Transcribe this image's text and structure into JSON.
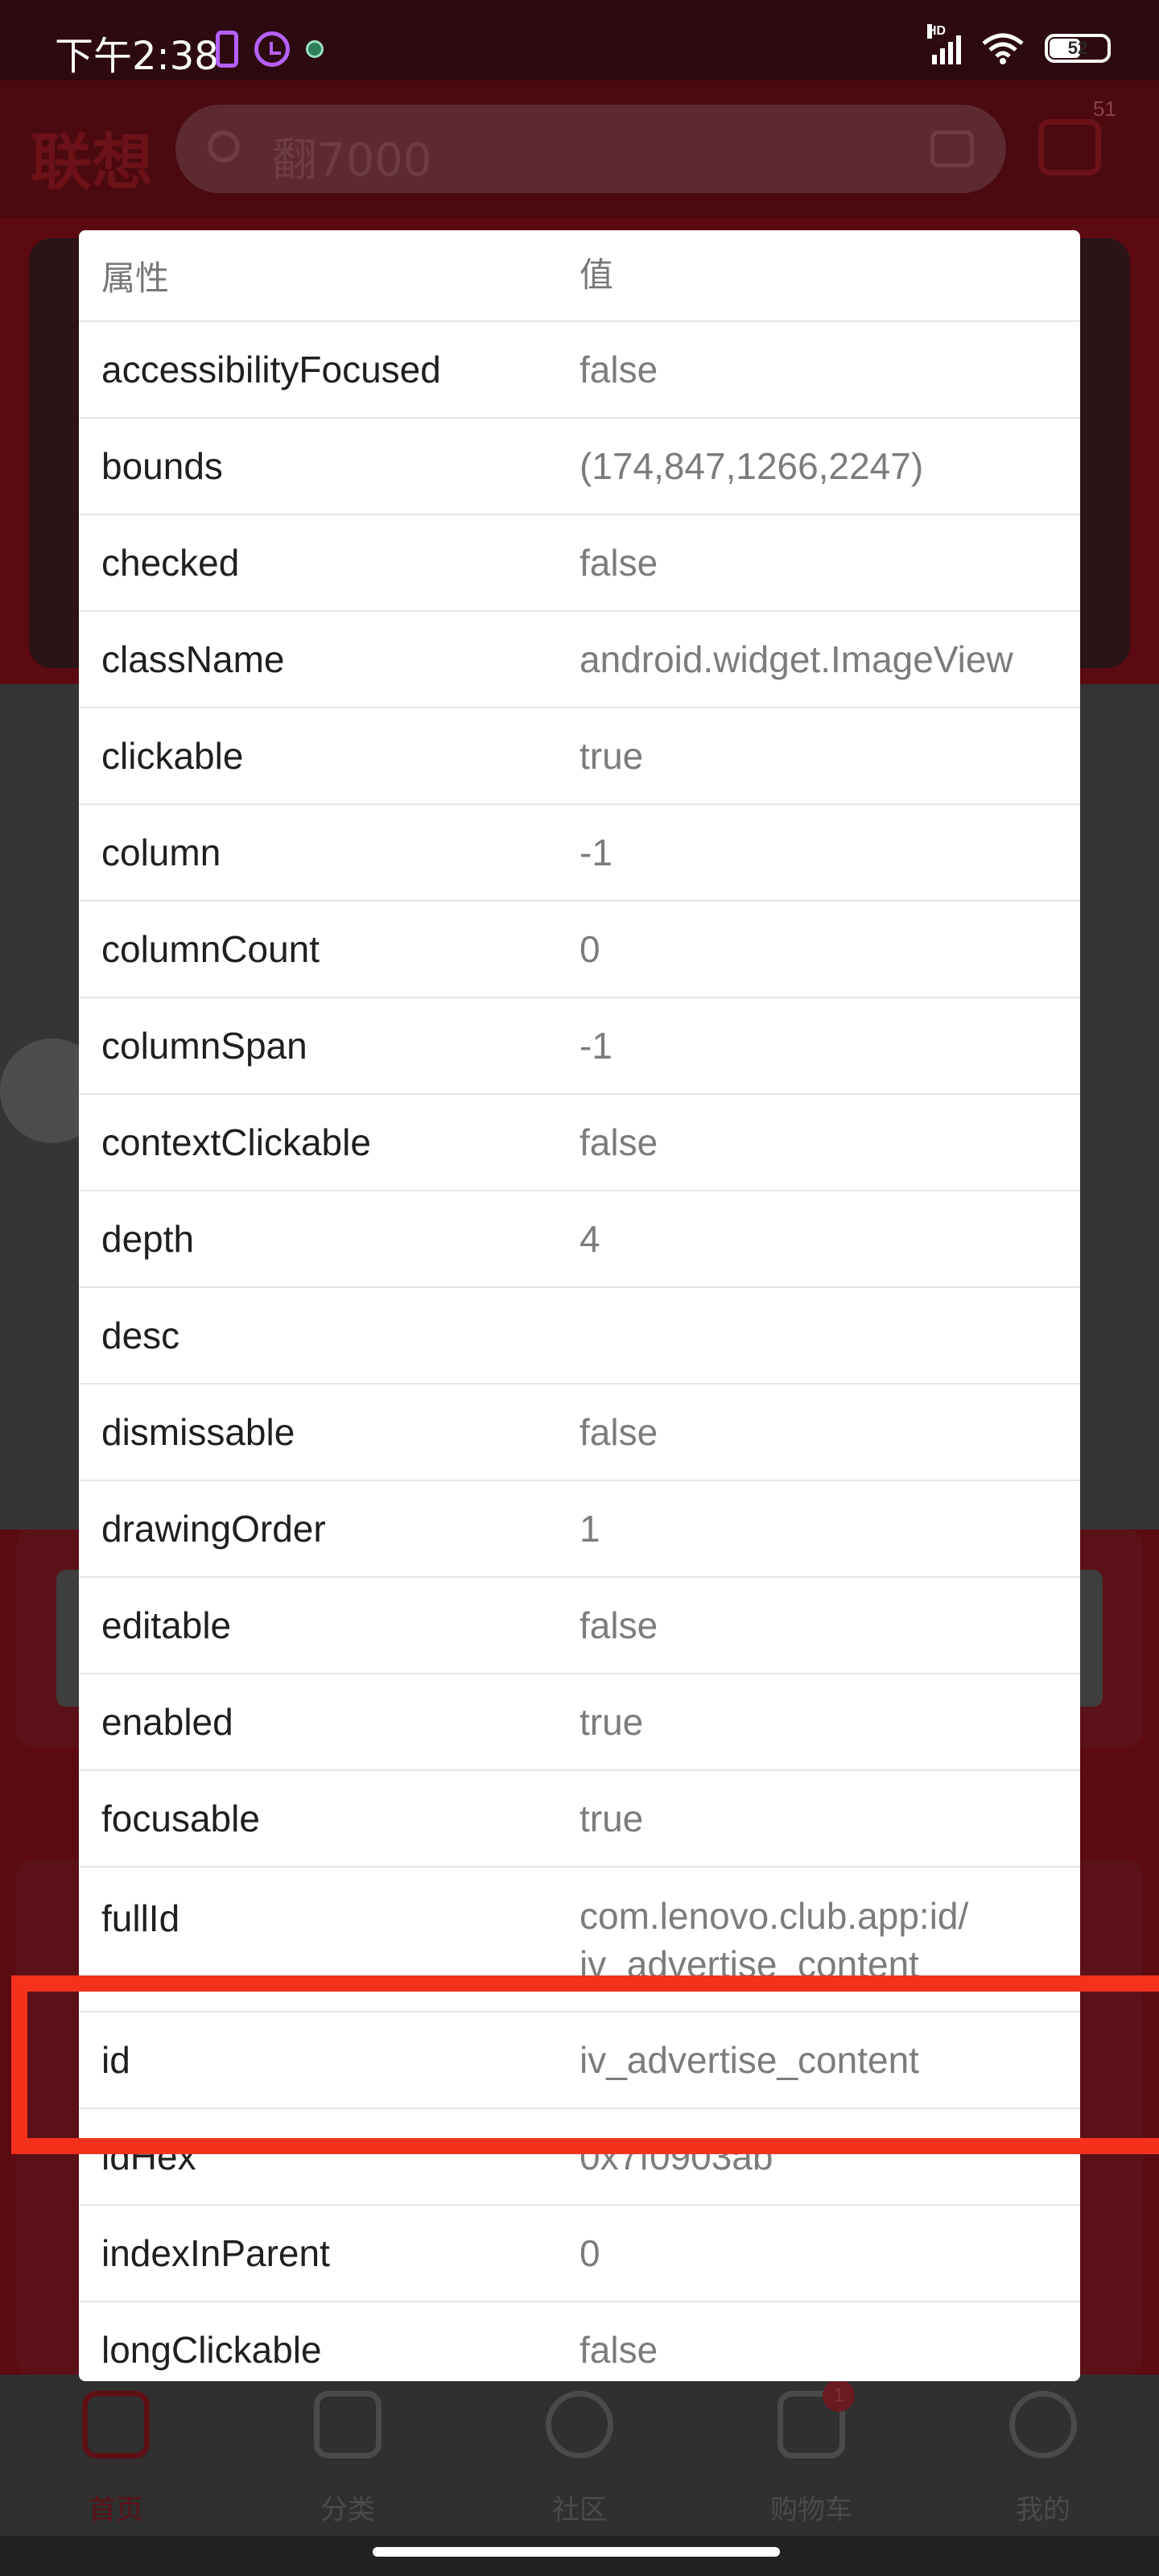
{
  "status_bar": {
    "time": "下午2:38",
    "battery": "52",
    "network_label": "HD"
  },
  "app": {
    "logo": "联想",
    "search_placeholder": "翻7000",
    "message_count": "51"
  },
  "bottom_nav": [
    {
      "label": "首页",
      "icon": "home-icon"
    },
    {
      "label": "分类",
      "icon": "grid-icon"
    },
    {
      "label": "社区",
      "icon": "planet-icon"
    },
    {
      "label": "购物车",
      "icon": "cart-icon",
      "badge": "1"
    },
    {
      "label": "我的",
      "icon": "smile-icon"
    }
  ],
  "panel": {
    "header": {
      "key": "属性",
      "value": "值"
    },
    "rows": [
      {
        "key": "accessibilityFocused",
        "value": "false"
      },
      {
        "key": "bounds",
        "value": "(174,847,1266,2247)"
      },
      {
        "key": "checked",
        "value": "false"
      },
      {
        "key": "className",
        "value": "android.widget.ImageView"
      },
      {
        "key": "clickable",
        "value": "true"
      },
      {
        "key": "column",
        "value": "-1"
      },
      {
        "key": "columnCount",
        "value": "0"
      },
      {
        "key": "columnSpan",
        "value": "-1"
      },
      {
        "key": "contextClickable",
        "value": "false"
      },
      {
        "key": "depth",
        "value": "4"
      },
      {
        "key": "desc",
        "value": ""
      },
      {
        "key": "dismissable",
        "value": "false"
      },
      {
        "key": "drawingOrder",
        "value": "1"
      },
      {
        "key": "editable",
        "value": "false"
      },
      {
        "key": "enabled",
        "value": "true"
      },
      {
        "key": "focusable",
        "value": "true"
      },
      {
        "key": "fullId",
        "value": "com.lenovo.club.app:id/ iv_advertise_content"
      },
      {
        "key": "id",
        "value": "iv_advertise_content"
      },
      {
        "key": "idHex",
        "value": "0x7f0903ab"
      },
      {
        "key": "indexInParent",
        "value": "0"
      },
      {
        "key": "longClickable",
        "value": "false"
      }
    ]
  },
  "colors": {
    "highlight": "#f5311c",
    "panel_bg": "#ffffff",
    "value_text": "#7c7c7c"
  }
}
